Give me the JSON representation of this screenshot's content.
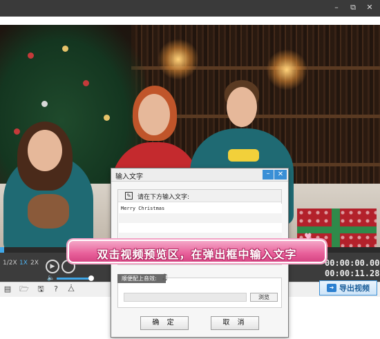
{
  "window": {
    "minimize_icon": "minimize-icon",
    "restore_icon": "restore-icon",
    "close_icon": "close-icon"
  },
  "playback": {
    "speeds": [
      "1/2X",
      "1X",
      "2X"
    ],
    "active_speed": "1X",
    "progress": 0.0,
    "volume": 0.95,
    "current_time": "00:00:00.000",
    "total_time": "00:00:11.280"
  },
  "toolbar": {
    "icons": [
      "new-project-icon",
      "open-folder-icon",
      "save-icon",
      "help-icon",
      "share-icon"
    ],
    "export_label": "导出视频"
  },
  "dialog": {
    "title": "输入文字",
    "prompt": "请在下方输入文字:",
    "text_value": "Merry Christmas",
    "music_label": "顺便配上音效:",
    "browse_label": "浏览",
    "ok_label": "确 定",
    "cancel_label": "取 消"
  },
  "callout": {
    "text": "双击视频预览区，在弹出框中输入文字"
  },
  "colors": {
    "accent": "#3a8fd6",
    "callout": "#e8609a",
    "titlebar": "#3a3a3a"
  }
}
